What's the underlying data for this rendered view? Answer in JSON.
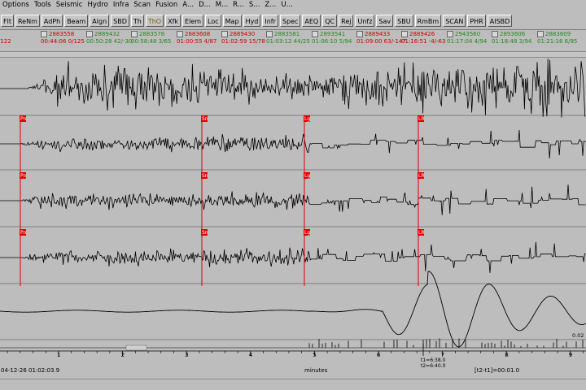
{
  "menu": [
    "Options",
    "Tools",
    "Seismic",
    "Hydro",
    "Infra",
    "Scan",
    "Fusion",
    "A...",
    "D...",
    "M...",
    "R...",
    "S...",
    "Z...",
    "U..."
  ],
  "toolbar": [
    {
      "label": "Flt",
      "selected": false
    },
    {
      "label": "ReNm",
      "selected": false
    },
    {
      "label": "AdPh",
      "selected": false
    },
    {
      "label": "Beam",
      "selected": false
    },
    {
      "label": "Algn",
      "selected": false
    },
    {
      "label": "SBD",
      "selected": false
    },
    {
      "label": "Th",
      "selected": false
    },
    {
      "label": "ThO",
      "selected": true
    },
    {
      "label": "Xfk",
      "selected": false
    },
    {
      "label": "Elem",
      "selected": false
    },
    {
      "label": "Loc",
      "selected": false
    },
    {
      "label": "Map",
      "selected": false
    },
    {
      "label": "Hyd",
      "selected": false
    },
    {
      "label": "Infr",
      "selected": false
    },
    {
      "label": "Spec",
      "selected": false
    },
    {
      "label": "AEQ",
      "selected": false
    },
    {
      "label": "QC",
      "selected": false
    },
    {
      "label": "Rej",
      "selected": false
    },
    {
      "label": "Unfz",
      "selected": false
    },
    {
      "label": "Sav",
      "selected": false
    },
    {
      "label": "SBU",
      "selected": false
    },
    {
      "label": "RmBm",
      "selected": false
    },
    {
      "label": "SCAN",
      "selected": false
    },
    {
      "label": "PHR",
      "selected": false
    },
    {
      "label": "AISBD",
      "selected": false
    }
  ],
  "origins": [
    {
      "id": "",
      "time": "/122",
      "color": "red"
    },
    {
      "id": "2883558",
      "time": "00:44:06 0/125",
      "color": "red"
    },
    {
      "id": "2889432",
      "time": "00:50:28 42/-30",
      "color": "green"
    },
    {
      "id": "2883578",
      "time": "00:58:48 3/65",
      "color": "green"
    },
    {
      "id": "2883608",
      "time": "01:00:55 4/87",
      "color": "red"
    },
    {
      "id": "2889430",
      "time": "01:02:59 15/78",
      "color": "red"
    },
    {
      "id": "2883581",
      "time": "01:03:12 44/25",
      "color": "green"
    },
    {
      "id": "2893541",
      "time": "01:06:10 5/94",
      "color": "green"
    },
    {
      "id": "2889433",
      "time": "01:09:00 63/-147",
      "color": "red"
    },
    {
      "id": "2889426",
      "time": "01:16:51 -4/-63",
      "color": "red"
    },
    {
      "id": "2943560",
      "time": "01:17:04 4/94",
      "color": "green"
    },
    {
      "id": "2893606",
      "time": "01:18:48 3/94",
      "color": "green"
    },
    {
      "id": "2883609",
      "time": "01:21:16 6/95",
      "color": "green"
    }
  ],
  "phases": [
    "Pn",
    "Sn",
    "Lg",
    "LR"
  ],
  "scale_value": "0.02",
  "axis": {
    "tick_labels": [
      "1",
      "2",
      "3",
      "4",
      "5",
      "6",
      "7",
      "8",
      "9"
    ],
    "unit_label": "minutes",
    "cursor_t1": "t1=6:38.0",
    "cursor_t2": "t2=6:40.0",
    "interval": "[t2-t1]=00:01.0",
    "start_time": "04-12-26 01:02:03.9"
  },
  "colors": {
    "background": "#bdbdbd",
    "trace": "#000000",
    "pick_line": "#e00000",
    "pick_label_bg": "#e00000",
    "origin_red": "#c80000",
    "origin_green": "#1e8a1e"
  }
}
